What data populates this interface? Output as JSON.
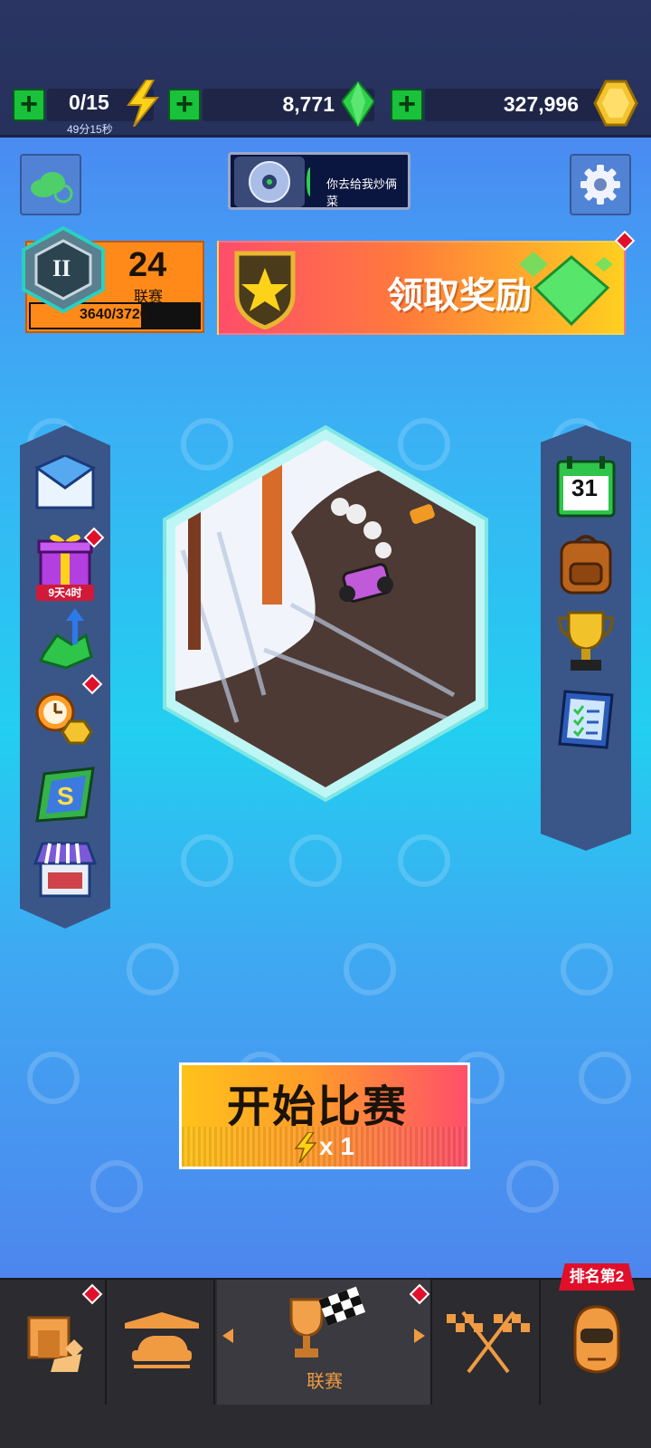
{
  "resources": {
    "energy_value": "0/15",
    "energy_timer": "49分15秒",
    "gems_value": "8,771",
    "coins_value": "327,996"
  },
  "chat": {
    "message": "你去给我炒俩菜"
  },
  "league": {
    "rank_roman": "II",
    "level": "24",
    "label": "联赛",
    "progress_text": "3640/3720",
    "progress": 0.978
  },
  "reward_banner": {
    "label": "领取奖励"
  },
  "left_menu": {
    "gift_timer": "9天4时"
  },
  "right_menu": {
    "calendar_day": "31"
  },
  "start_button": {
    "label": "开始比赛",
    "cost": "x 1"
  },
  "bottom_nav": {
    "active_label": "联赛",
    "rank_badge": "排名第2"
  },
  "colors": {
    "accent_orange": "#ff8a1a",
    "gem_green": "#2fd14a",
    "coin_gold": "#f4c430",
    "alert_red": "#e0102b"
  }
}
